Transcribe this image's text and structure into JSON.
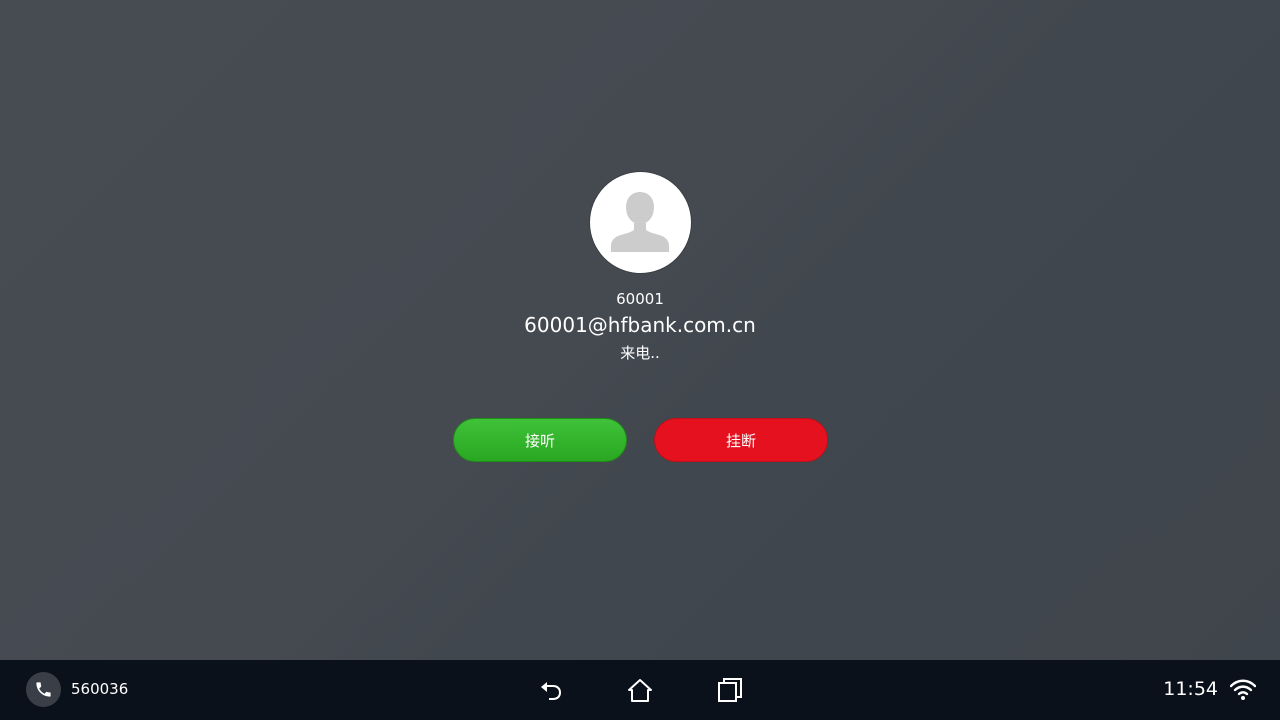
{
  "call": {
    "caller_number": "60001",
    "caller_uri": "60001@hfbank.com.cn",
    "status": "来电.."
  },
  "actions": {
    "answer_label": "接听",
    "hangup_label": "挂断"
  },
  "navbar": {
    "extension": "560036",
    "clock": "11:54",
    "icons": [
      "phone-icon",
      "back-icon",
      "home-icon",
      "recent-apps-icon",
      "wifi-icon"
    ]
  },
  "colors": {
    "background": "#44494f",
    "answer": "#32b52b",
    "hangup": "#e5111f",
    "navbar": "#0b111a"
  }
}
